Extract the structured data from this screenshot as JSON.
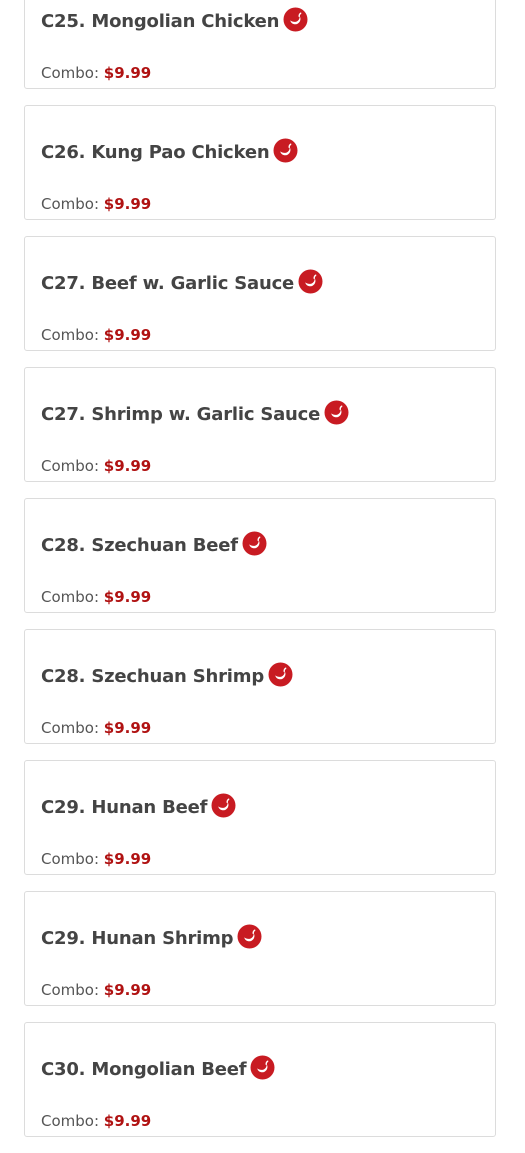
{
  "colors": {
    "accent": "#b01212",
    "title_text": "#444444",
    "body_text": "#555555",
    "card_border": "#dcdcdc"
  },
  "icons": {
    "spicy": "chili-pepper-icon"
  },
  "menu_items": [
    {
      "name": "C25. Mongolian Chicken",
      "spicy": true,
      "price_label": "Combo:",
      "price": "$9.99"
    },
    {
      "name": "C26. Kung Pao Chicken",
      "spicy": true,
      "price_label": "Combo:",
      "price": "$9.99"
    },
    {
      "name": "C27. Beef w. Garlic Sauce",
      "spicy": true,
      "price_label": "Combo:",
      "price": "$9.99"
    },
    {
      "name": "C27. Shrimp w. Garlic Sauce",
      "spicy": true,
      "price_label": "Combo:",
      "price": "$9.99"
    },
    {
      "name": "C28. Szechuan Beef",
      "spicy": true,
      "price_label": "Combo:",
      "price": "$9.99"
    },
    {
      "name": "C28. Szechuan Shrimp",
      "spicy": true,
      "price_label": "Combo:",
      "price": "$9.99"
    },
    {
      "name": "C29. Hunan Beef",
      "spicy": true,
      "price_label": "Combo:",
      "price": "$9.99"
    },
    {
      "name": "C29. Hunan Shrimp",
      "spicy": true,
      "price_label": "Combo:",
      "price": "$9.99"
    },
    {
      "name": "C30. Mongolian Beef",
      "spicy": true,
      "price_label": "Combo:",
      "price": "$9.99"
    }
  ]
}
